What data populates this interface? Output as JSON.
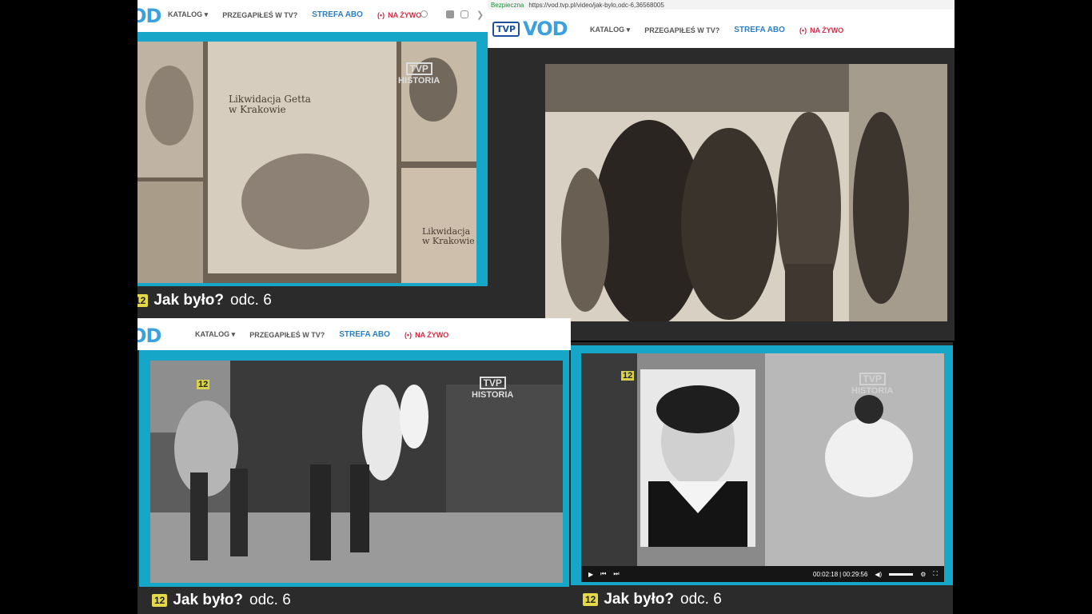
{
  "nav": {
    "katalog": "KATALOG",
    "przegapiles": "PRZEGAPIŁEŚ W TV?",
    "strefa": "STREFA ABO",
    "live": "NA ŻYWO",
    "live_icon": "(•)"
  },
  "logo": {
    "vod": "VOD",
    "tvp": "TVP"
  },
  "top_right_browser": {
    "secure_label": "Bezpieczna",
    "url": "https://vod.tvp.pl/video/jak-bylo,odc-6,36568005"
  },
  "watermark": {
    "box": "TVP",
    "label": "HISTORIA"
  },
  "show": {
    "age_rating": "12",
    "title": "Jak było?",
    "episode": "odc. 6"
  },
  "panel1_overlay": {
    "caption_main": "Likwidacja Getta w Krakowie",
    "caption_side": "Likwidacja w Krakowie"
  },
  "player": {
    "time_current": "00:02:18",
    "time_total": "00:29:56",
    "play_icon": "play-icon",
    "prev_icon": "prev-icon",
    "next_icon": "next-icon"
  },
  "colors": {
    "accent": "#16a7c8",
    "vod_blue": "#3ba0dc",
    "live_red": "#d62a44",
    "age_yellow": "#e5d94a"
  }
}
